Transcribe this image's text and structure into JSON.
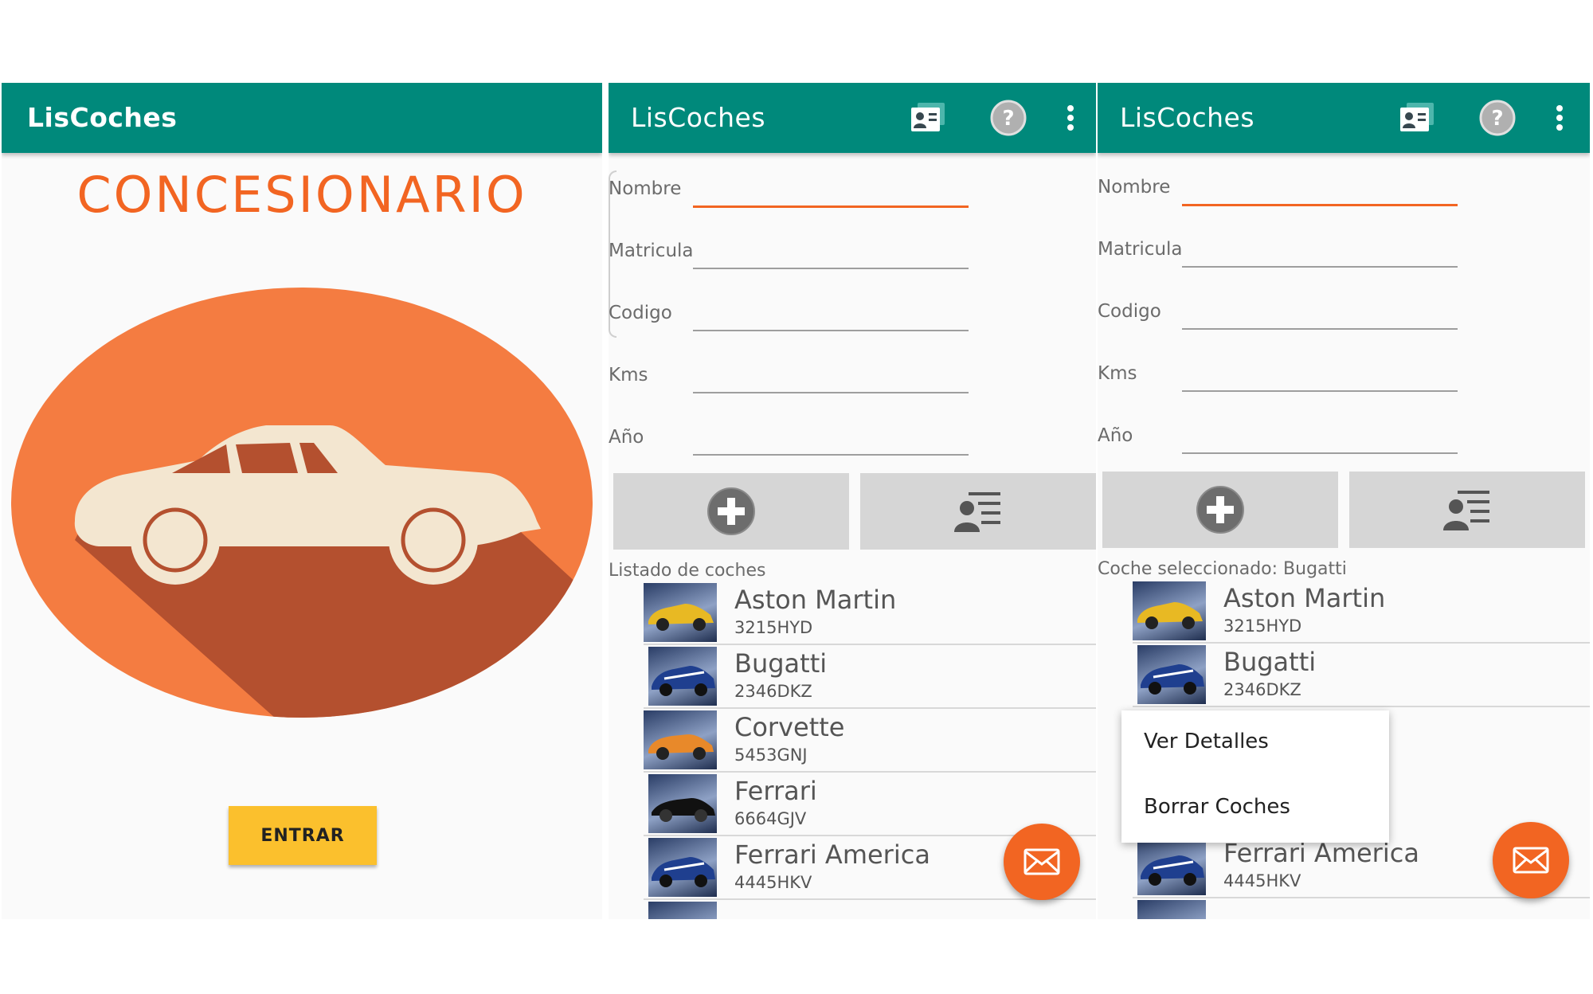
{
  "app": {
    "title": "LisCoches"
  },
  "splash": {
    "heading": "CONCESIONARIO",
    "enter_label": "ENTRAR"
  },
  "form": {
    "fields": [
      {
        "label": "Nombre",
        "value": ""
      },
      {
        "label": "Matricula",
        "value": ""
      },
      {
        "label": "Codigo",
        "value": ""
      },
      {
        "label": "Kms",
        "value": ""
      },
      {
        "label": "Año",
        "value": ""
      }
    ]
  },
  "screen2": {
    "list_caption": "Listado de coches"
  },
  "screen3": {
    "list_caption": "Coche seleccionado: Bugatti"
  },
  "cars": [
    {
      "name": "Aston Martin",
      "plate": "3215HYD",
      "color": "#e8b923"
    },
    {
      "name": "Bugatti",
      "plate": "2346DKZ",
      "color": "#1f3f8f"
    },
    {
      "name": "Corvette",
      "plate": "5453GNJ",
      "color": "#e8892a"
    },
    {
      "name": "Ferrari",
      "plate": "6664GJV",
      "color": "#111111"
    },
    {
      "name": "Ferrari America",
      "plate": "4445HKV",
      "color": "#1f3f8f"
    }
  ],
  "context_menu": {
    "items": [
      "Ver Detalles",
      "Borrar Coches"
    ]
  },
  "colors": {
    "primary": "#00897b",
    "accent": "#f26522",
    "enter_button": "#fbc02d"
  },
  "icons": {
    "app_bar_actions": [
      "contact-card-icon",
      "help-icon",
      "more-vert-icon"
    ],
    "add": "add-circle-icon",
    "list": "person-list-icon",
    "fab": "mail-icon"
  }
}
